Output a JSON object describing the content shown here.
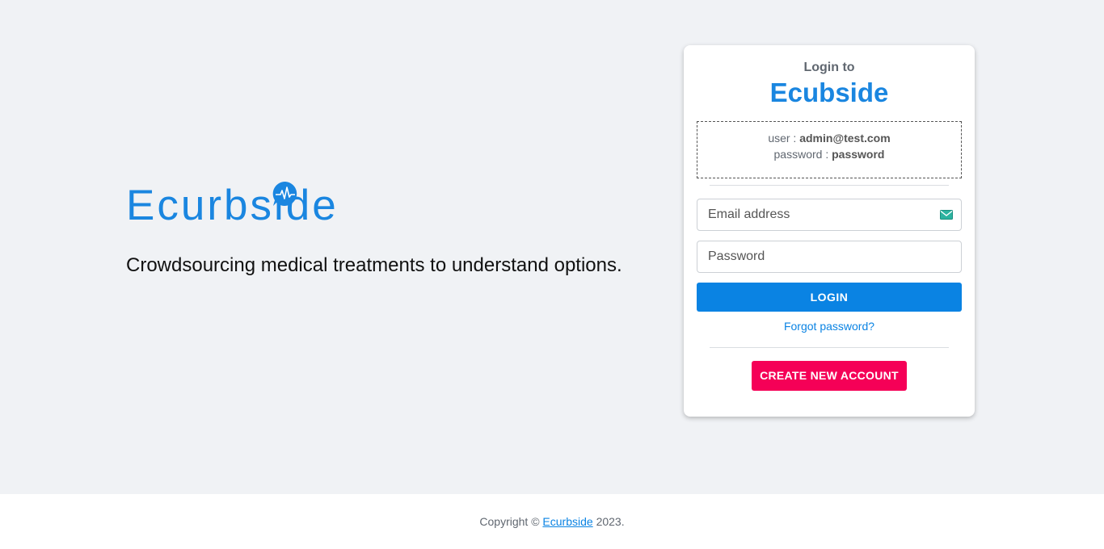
{
  "brand": {
    "logo_text": "Ecurbside",
    "tagline": "Crowdsourcing medical treatments to understand options."
  },
  "card": {
    "pre_title": "Login to",
    "title": "Ecubside",
    "credentials": {
      "user_label": "user :",
      "user_value": "admin@test.com",
      "password_label": "password :",
      "password_value": "password"
    },
    "email_placeholder": "Email address",
    "password_placeholder": "Password",
    "login_label": "LOGIN",
    "forgot_label": "Forgot password?",
    "create_label": "CREATE NEW ACCOUNT"
  },
  "footer": {
    "prefix": "Copyright ©",
    "link": "Ecurbside",
    "suffix": "2023."
  },
  "colors": {
    "brand_blue": "#1a86e0",
    "primary": "#0a83e3",
    "accent_pink": "#f50057",
    "background": "#f0f2f5"
  },
  "icons": {
    "logo_bubble": "heartbeat-bubble-icon",
    "email_field": "email-icon"
  }
}
